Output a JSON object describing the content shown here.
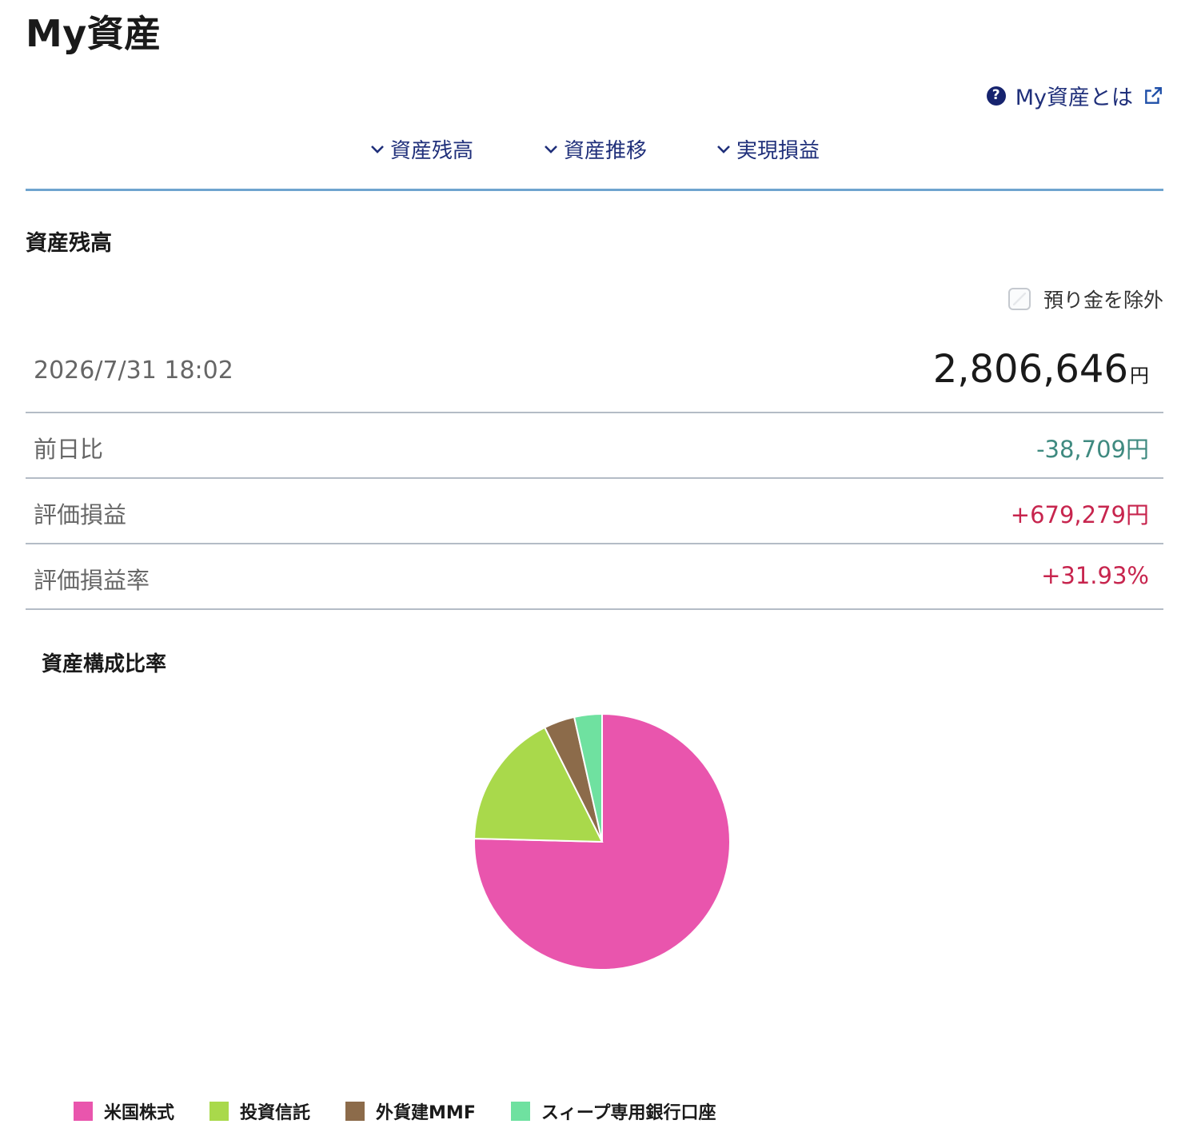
{
  "page": {
    "title": "My資産"
  },
  "help": {
    "label": "My資産とは",
    "icon": "question-circle-icon",
    "external_icon": "external-link-icon"
  },
  "nav": {
    "items": [
      {
        "label": "資産残高",
        "icon": "chevron-down-icon"
      },
      {
        "label": "資産推移",
        "icon": "chevron-down-icon"
      },
      {
        "label": "実現損益",
        "icon": "chevron-down-icon"
      }
    ]
  },
  "section": {
    "title": "資産残高"
  },
  "exclude_deposit": {
    "label": "預り金を除外",
    "checked": false
  },
  "balance": {
    "timestamp": "2026/7/31 18:02",
    "total": "2,806,646",
    "unit": "円"
  },
  "rows": [
    {
      "label": "前日比",
      "value": "-38,709円",
      "tone": "negative"
    },
    {
      "label": "評価損益",
      "value": "+679,279円",
      "tone": "positive"
    },
    {
      "label": "評価損益率",
      "value": "+31.93%",
      "tone": "positive"
    }
  ],
  "colors": {
    "accent": "#1f2f7a",
    "nav_underline": "#6fa4cf",
    "negative": "#3f8a80",
    "positive": "#c7254e"
  },
  "chart_data": {
    "type": "pie",
    "title": "資産構成比率",
    "legend_position": "bottom",
    "slices": [
      {
        "name": "米国株式",
        "value": 75.4,
        "color": "#e955ad"
      },
      {
        "name": "投資信託",
        "value": 17.2,
        "color": "#a9d94b"
      },
      {
        "name": "外貨建MMF",
        "value": 3.9,
        "color": "#8c6b4a"
      },
      {
        "name": "スィープ専用銀行口座",
        "value": 3.5,
        "color": "#6fe1a0"
      }
    ]
  }
}
